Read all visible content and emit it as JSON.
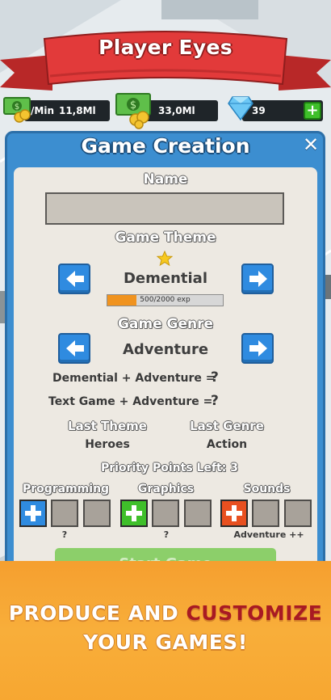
{
  "header": {
    "title": "Player Eyes"
  },
  "currency": {
    "income_label": "/Min",
    "income_value": "11,8Ml",
    "cash_value": "33,0Ml",
    "gems_value": "39",
    "add_gems_label": "+"
  },
  "dialog": {
    "title": "Game Creation",
    "close_label": "✕",
    "name_label": "Name",
    "name_value": "",
    "theme_label": "Game Theme",
    "theme_value": "Demential",
    "theme_xp_text": "500/2000 exp",
    "theme_xp_fraction": 0.25,
    "genre_label": "Game Genre",
    "genre_value": "Adventure",
    "combo_1": "Demential + Adventure =",
    "combo_2": "Text Game + Adventure =",
    "combo_unknown": "?",
    "last_theme_label": "Last Theme",
    "last_theme_value": "Heroes",
    "last_genre_label": "Last Genre",
    "last_genre_value": "Action",
    "priority_label": "Priority Points Left:",
    "priority_value": "3",
    "categories": [
      {
        "label": "Programming",
        "note": "?"
      },
      {
        "label": "Graphics",
        "note": "?"
      },
      {
        "label": "Sounds",
        "note": "Adventure ++"
      }
    ],
    "start_label": "Start Game"
  },
  "promo": {
    "line1_a": "PRODUCE AND",
    "line1_b": "CUSTOMIZE",
    "line2": "YOUR GAMES!"
  },
  "colors": {
    "panel_blue": "#3c8ed0",
    "ribbon_red": "#e23a3a",
    "banner_orange": "#f59f2f",
    "accent_red": "#a81a23",
    "button_green": "#3fbf2a"
  }
}
